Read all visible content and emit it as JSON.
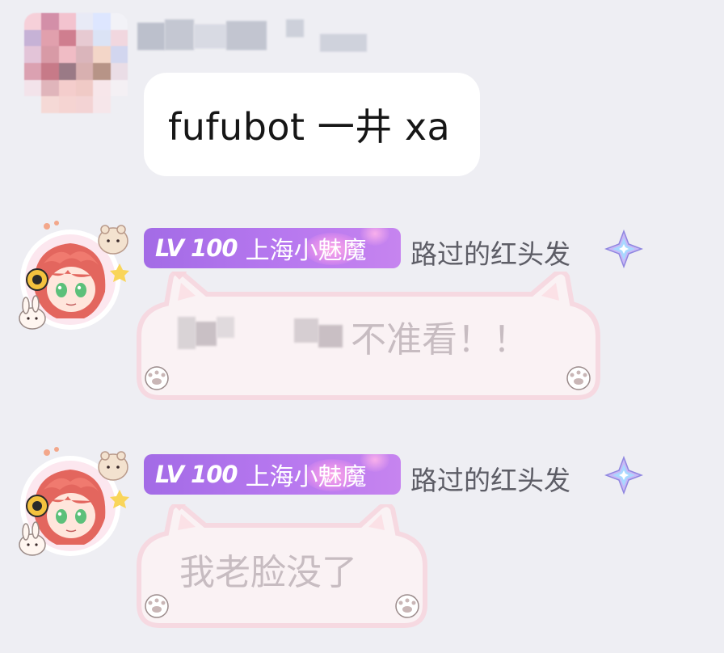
{
  "messages": [
    {
      "text": "fufubot 一井 xa"
    },
    {
      "level": "LV 100",
      "group_title": "上海小魅魔",
      "honor_title": "路过的红头发",
      "text": "不准看！！"
    },
    {
      "level": "LV 100",
      "group_title": "上海小魅魔",
      "honor_title": "路过的红头发",
      "text": "我老脸没了"
    }
  ],
  "colors": {
    "background": "#eeeef3",
    "bubble": "#ffffff",
    "badge_purple": "#b778ef",
    "cat_frame_pink": "#f5d3dc"
  },
  "icons": [
    "avatar",
    "crystal-diamond-icon",
    "cat-ear-frame",
    "paw-icon",
    "heart-icon"
  ]
}
